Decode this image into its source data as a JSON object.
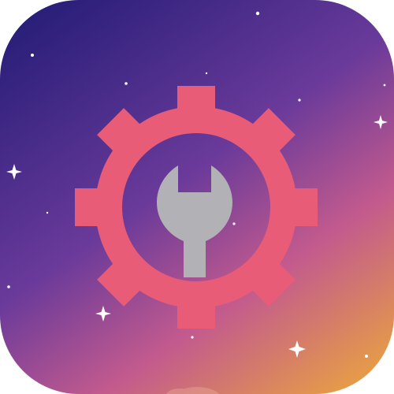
{
  "icon": {
    "name": "settings-tool-app-icon",
    "symbol": "gear-with-wrench",
    "colors": {
      "background_top": "#2a1f7a",
      "background_mid": "#6a3a9a",
      "background_pink": "#c25a8e",
      "background_bottom": "#e59a4a",
      "gear": "#e85c78",
      "wrench": "#b2b2b6",
      "stars": "#ffffff"
    }
  }
}
